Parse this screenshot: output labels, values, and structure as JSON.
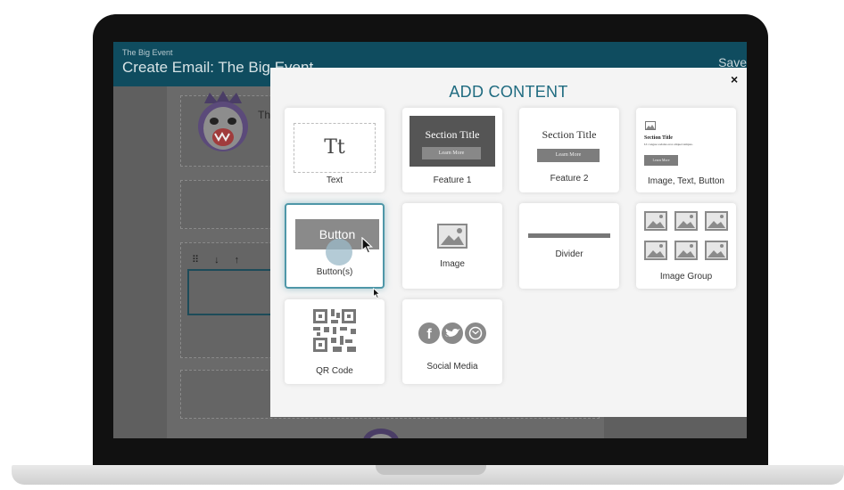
{
  "app": {
    "subtitle": "The Big Event",
    "title": "Create Email: The Big Event",
    "save_label": "Save",
    "canvas_text_fragment": "Th",
    "arrows": "⠿ ↓ ↑"
  },
  "modal": {
    "title": "ADD CONTENT",
    "close_glyph": "×",
    "tiles": [
      {
        "label": "Text",
        "preview_text": "Tt"
      },
      {
        "label": "Feature 1",
        "section_title": "Section Title",
        "button": "Learn More"
      },
      {
        "label": "Feature 2",
        "section_title": "Section Title",
        "button": "Learn More"
      },
      {
        "label": "Image, Text, Button",
        "section_title": "Section Title",
        "body": "Ut congue sodales eros aliquet tempus.",
        "button": "Learn More"
      },
      {
        "label": "Button(s)",
        "button": "Button"
      },
      {
        "label": "Image"
      },
      {
        "label": "Divider"
      },
      {
        "label": "Image Group"
      },
      {
        "label": "QR Code"
      },
      {
        "label": "Social Media"
      }
    ]
  },
  "colors": {
    "header": "#0f4c5f",
    "accent": "#1f6b80",
    "selected_border": "#4e97a8"
  }
}
